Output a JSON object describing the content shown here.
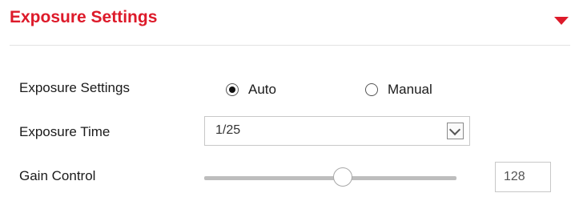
{
  "header": {
    "title": "Exposure Settings",
    "accent_color": "#dd1a2a",
    "toggle_icon": "caret-down-icon"
  },
  "exposure_mode": {
    "label": "Exposure Settings",
    "options": [
      {
        "label": "Auto",
        "selected": true
      },
      {
        "label": "Manual",
        "selected": false
      }
    ]
  },
  "exposure_time": {
    "label": "Exposure Time",
    "value": "1/25",
    "dropdown_icon": "chevron-down-icon"
  },
  "gain_control": {
    "label": "Gain Control",
    "slider_fraction": 0.55,
    "value": "128"
  }
}
